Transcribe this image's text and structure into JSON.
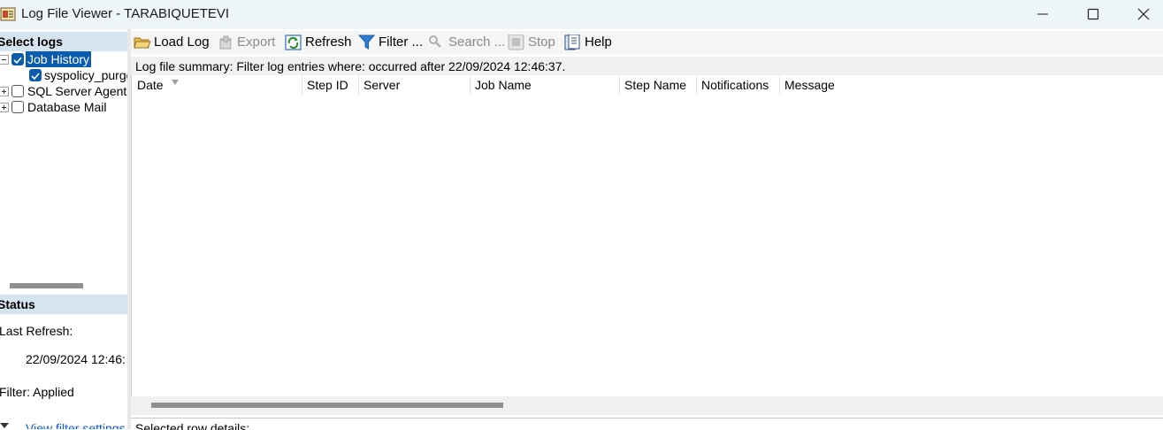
{
  "window": {
    "title": "Log File Viewer - TARABIQUETEVI"
  },
  "left": {
    "select_logs_header": "Select logs",
    "tree": [
      {
        "label": "Job History",
        "checked": true,
        "expanded": true,
        "selected": true
      },
      {
        "label": "syspolicy_purge",
        "checked": true,
        "child": true
      },
      {
        "label": "SQL Server Agent",
        "checked": false,
        "expanded": false
      },
      {
        "label": "Database Mail",
        "checked": false,
        "expanded": false
      }
    ],
    "status_header": "Status",
    "last_refresh_label": "Last Refresh:",
    "last_refresh_value": "22/09/2024 12:46:",
    "filter_status": "Filter: Applied",
    "view_filter_link": "View filter settings"
  },
  "toolbar": {
    "load_log": "Load Log",
    "export": "Export",
    "refresh": "Refresh",
    "filter": "Filter ...",
    "search": "Search ...",
    "stop": "Stop",
    "help": "Help"
  },
  "summary": "Log file summary: Filter log entries where: occurred after 22/09/2024 12:46:37.",
  "grid": {
    "columns": [
      "Date",
      "Step ID",
      "Server",
      "Job Name",
      "Step Name",
      "Notifications",
      "Message"
    ]
  },
  "details_label": "Selected row details:",
  "colors": {
    "selection": "#0b5cad",
    "section_header": "#d6e4f0",
    "titlebar": "#eef6f9"
  }
}
